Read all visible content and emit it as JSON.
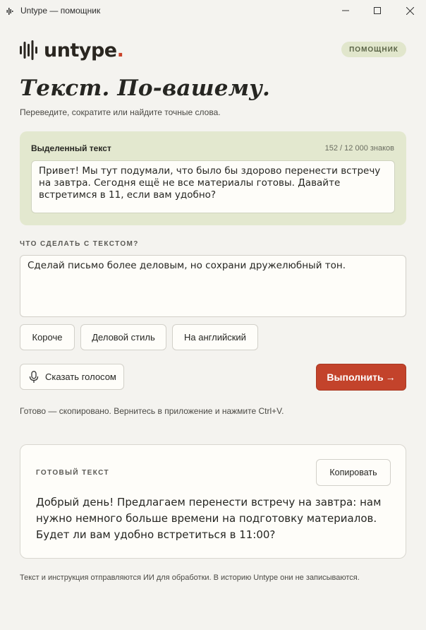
{
  "window": {
    "title": "Untype — помощник",
    "controls": {
      "minimize": "minimize-icon",
      "maximize": "maximize-icon",
      "close": "close-icon"
    }
  },
  "header": {
    "logo_text": "untype",
    "logo_dot": ".",
    "badge": "помощник",
    "headline": "Текст. По-вашему.",
    "subhead": "Переведите, сократите или найдите точные слова."
  },
  "selection": {
    "label": "Выделенный текст",
    "count": "152 / 12 000 знаков",
    "text": "Привет! Мы тут подумали, что было бы здорово перенести встречу на завтра. Сегодня ещё не все материалы готовы. Давайте встретимся в 11, если вам удобно?"
  },
  "instruction": {
    "label": "Что сделать с текстом?",
    "value": "Сделай письмо более деловым, но сохрани дружелюбный тон."
  },
  "chips": [
    "Короче",
    "Деловой стиль",
    "На английский"
  ],
  "actions": {
    "voice_label": "Сказать голосом",
    "execute_label": "Выполнить",
    "execute_arrow": "→"
  },
  "status": "Готово — скопировано. Вернитесь в приложение и нажмите Ctrl+V.",
  "result": {
    "label": "Готовый текст",
    "copy_label": "Копировать",
    "text": "Добрый день! Предлагаем перенести встречу на завтра: нам нужно немного больше времени на подготовку материалов. Будет ли вам удобно встретиться в 11:00?"
  },
  "footer": "Текст и инструкция отправляются ИИ для обработки. В историю Untype они не записываются.",
  "colors": {
    "background": "#f4f3ef",
    "accent": "#c3432b",
    "selection_card": "#e3e8cf",
    "badge": "#e1e6cc"
  }
}
